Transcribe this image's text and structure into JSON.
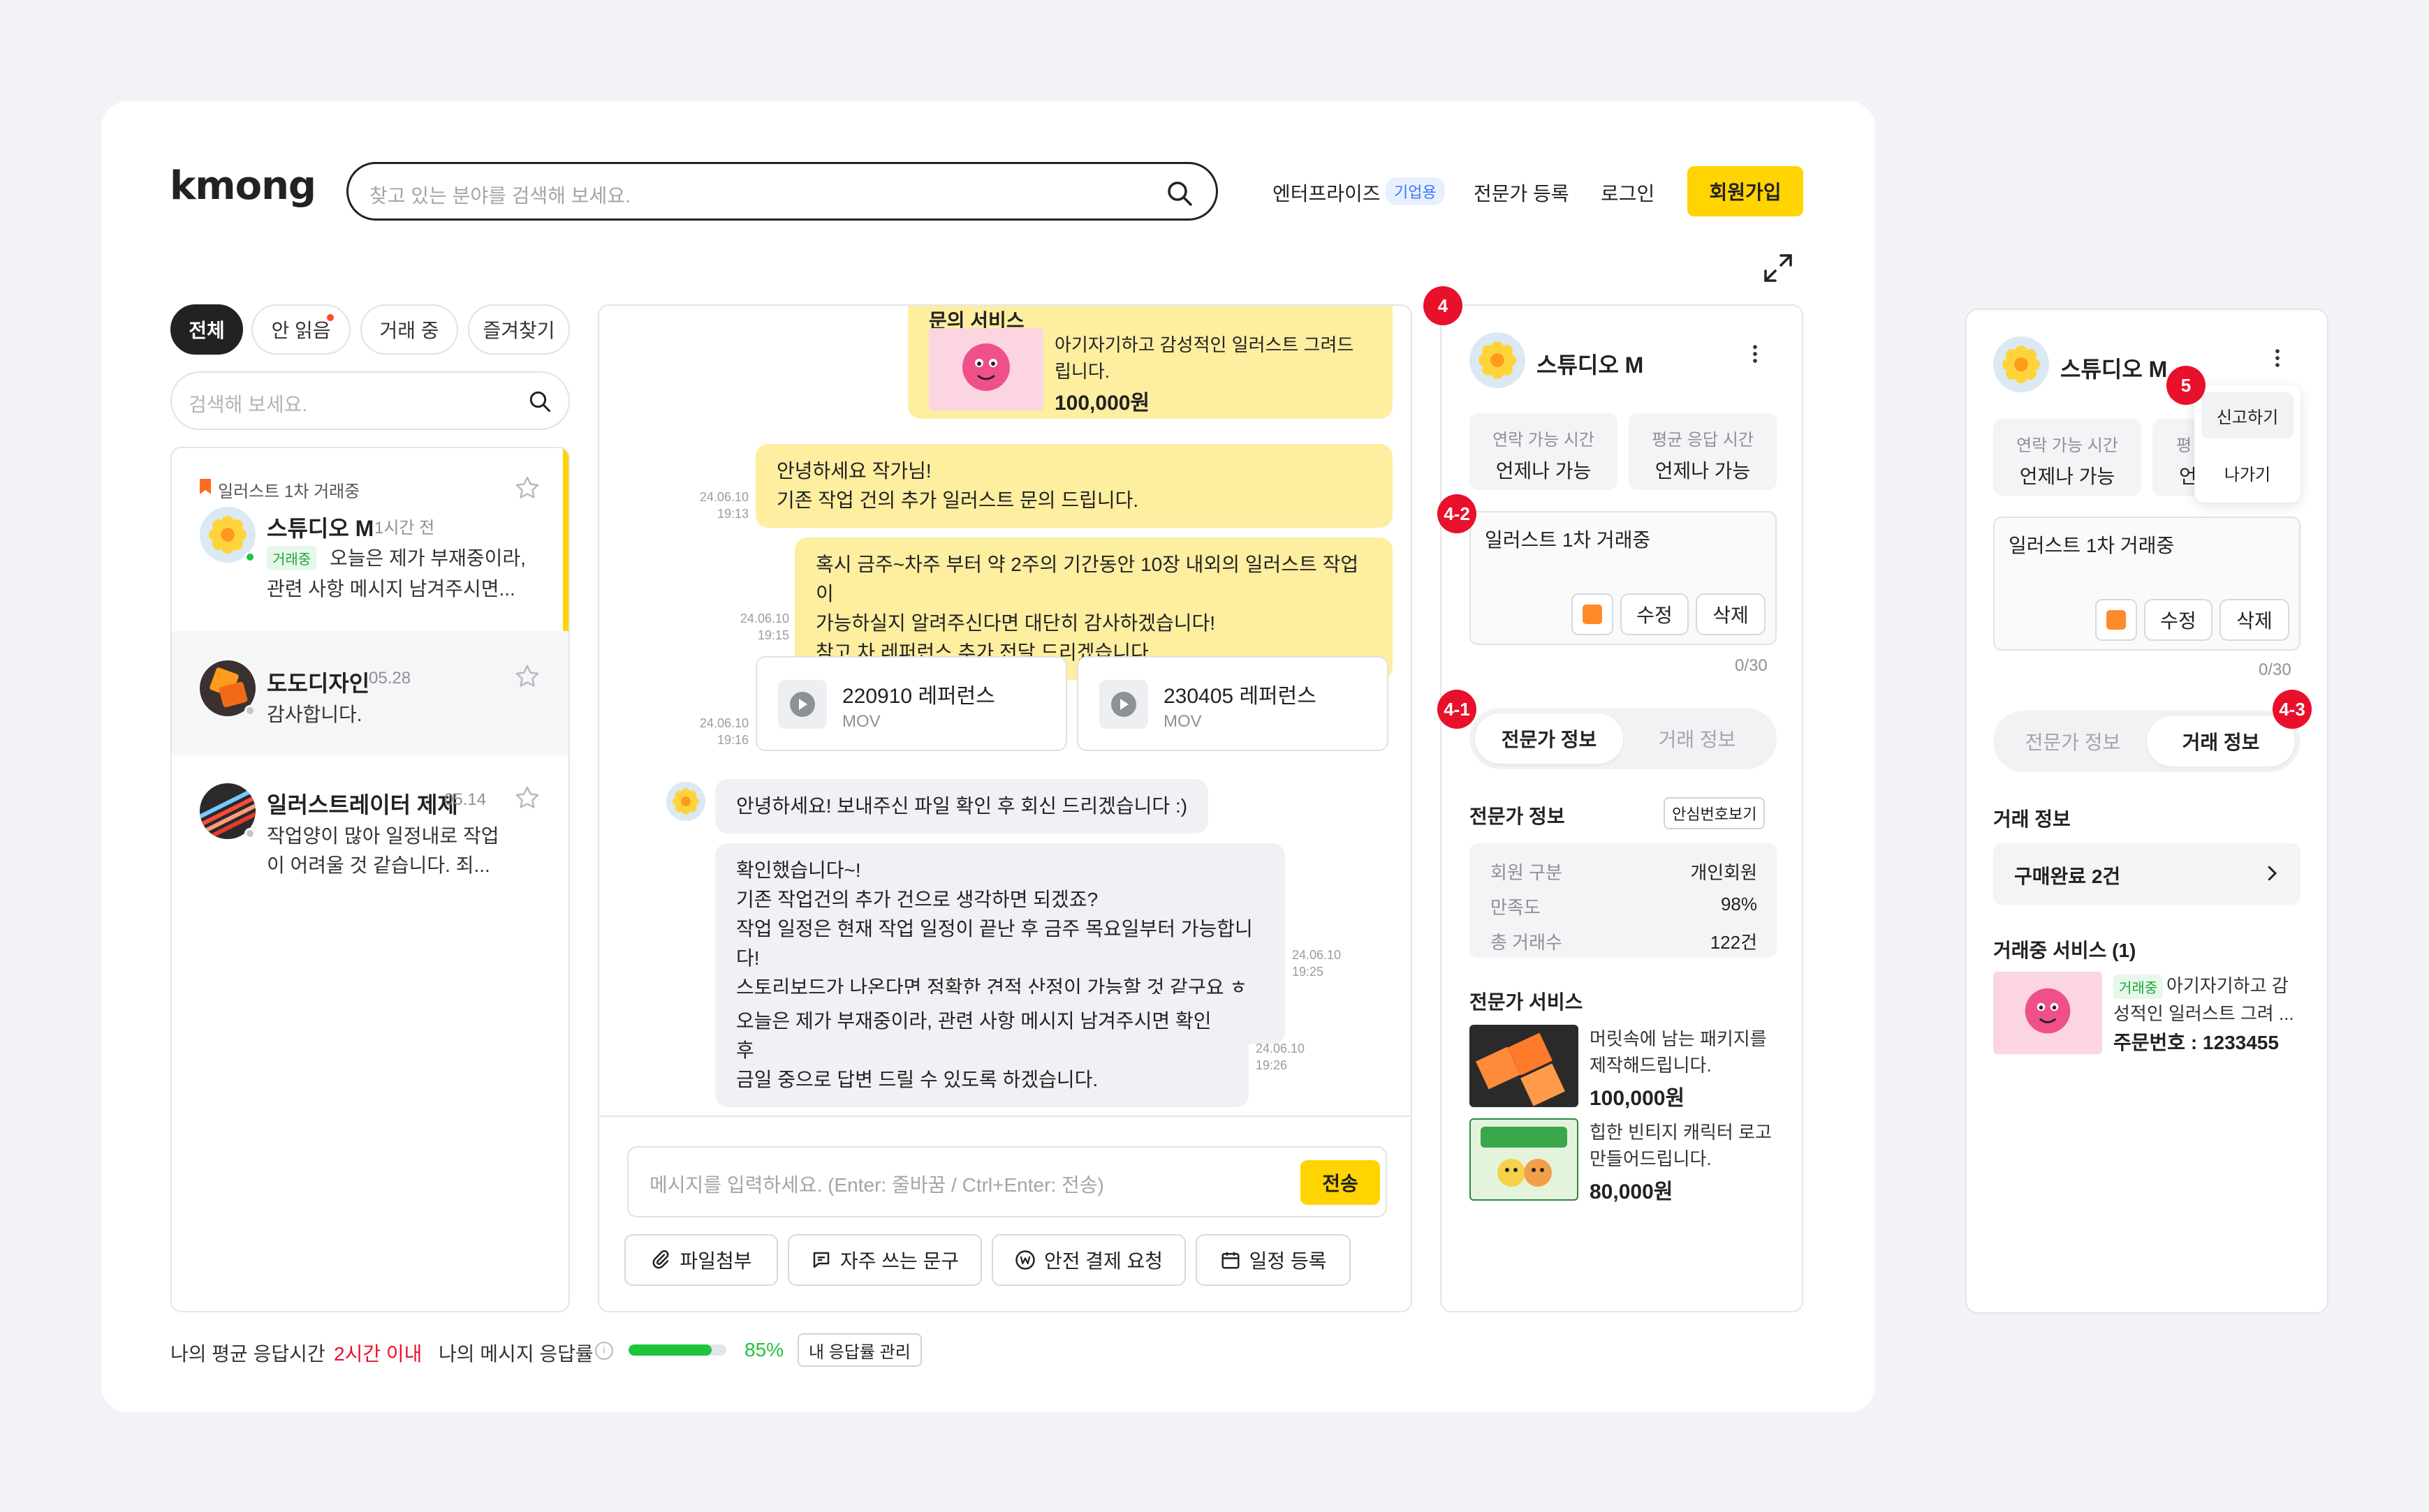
{
  "header": {
    "logo": "kmong",
    "search_placeholder": "찾고 있는 분야를 검색해 보세요.",
    "nav_enterprise": "엔터프라이즈",
    "nav_enterprise_badge": "기업용",
    "nav_expert_register": "전문가 등록",
    "nav_login": "로그인",
    "nav_signup": "회원가입"
  },
  "filters": {
    "all": "전체",
    "unread": "안 읽음",
    "trading": "거래 중",
    "favorites": "즐겨찾기"
  },
  "list_search_placeholder": "검색해 보세요.",
  "conversations": [
    {
      "tag": "일러스트 1차 거래중",
      "name": "스튜디오 M",
      "time": "1시간 전",
      "status": "거래중",
      "preview1": "오늘은 제가 부재중이라,",
      "preview2": "관련 사항 메시지 남겨주시면..."
    },
    {
      "name": "도도디자인",
      "time": "05.28",
      "preview1": "감사합니다."
    },
    {
      "name": "일러스트레이터 제제",
      "time": "05.14",
      "preview1": "작업양이 많아 일정내로 작업",
      "preview2": "이 어려울 것 같습니다. 죄..."
    }
  ],
  "chat": {
    "service_card_title": "문의 서비스",
    "service_card_desc1": "아기자기하고 감성적인 일러스트 그려드",
    "service_card_desc2": "립니다.",
    "service_card_price": "100,000원",
    "msg1_line1": "안녕하세요 작가님!",
    "msg1_line2": "기존 작업 건의 추가 일러스트 문의 드립니다.",
    "msg1_date": "24.06.10",
    "msg1_time": "19:13",
    "msg2_line1": "혹시 금주~차주 부터 약 2주의 기간동안 10장 내외의 일러스트 작업이",
    "msg2_line2": "가능하실지 알려주신다면 대단히 감사하겠습니다!",
    "msg2_line3": "참고 차 레퍼런스 추가 전달 드리겠습니다.",
    "msg2_date": "24.06.10",
    "msg2_time": "19:15",
    "file1_name": "220910 레퍼런스",
    "file1_type": "MOV",
    "file2_name": "230405 레퍼런스",
    "file2_type": "MOV",
    "files_date": "24.06.10",
    "files_time": "19:16",
    "reply1": "안녕하세요! 보내주신 파일 확인 후 회신 드리겠습니다 :)",
    "reply2_line1": "확인했습니다~!",
    "reply2_line2": "기존 작업건의 추가 건으로 생각하면 되겠죠?",
    "reply2_line3": "작업 일정은 현재 작업 일정이 끝난 후 금주 목요일부터 가능합니다!",
    "reply2_line4": "스토리보드가 나온다면 정확한 견적 산정이 가능할 것 같구요 ㅎㅎ",
    "reply2_date": "24.06.10",
    "reply2_time": "19:25",
    "reply3_line1": "오늘은 제가 부재중이라, 관련 사항 메시지 남겨주시면 확인 후",
    "reply3_line2": "금일 중으로 답변 드릴 수 있도록 하겠습니다.",
    "reply3_date": "24.06.10",
    "reply3_time": "19:26",
    "input_placeholder": "메시지를 입력하세요. (Enter: 줄바꿈 / Ctrl+Enter: 전송)",
    "send": "전송",
    "attach": "파일첨부",
    "phrases": "자주 쓰는 문구",
    "safe_pay": "안전 결제 요청",
    "schedule": "일정 등록"
  },
  "footer": {
    "avg_label": "나의 평균 응답시간",
    "avg_value": "2시간 이내",
    "rate_label": "나의 메시지 응답률",
    "rate_value": "85%",
    "rate_fraction": 0.85,
    "manage": "내 응답률 관리"
  },
  "profile": {
    "name": "스튜디오 M",
    "contact_label": "연락 가능 시간",
    "contact_value": "언제나 가능",
    "resp_label": "평균 응답 시간",
    "resp_value": "언제나 가능",
    "memo": "일러스트 1차 거래중",
    "edit": "수정",
    "delete": "삭제",
    "memo_count": "0/30",
    "tab_expert": "전문가 정보",
    "tab_trade": "거래 정보",
    "expert_info_title": "전문가 정보",
    "safe_number": "안심번호보기",
    "member_type_label": "회원 구분",
    "member_type_value": "개인회원",
    "satisfaction_label": "만족도",
    "satisfaction_value": "98%",
    "total_trades_label": "총 거래수",
    "total_trades_value": "122건",
    "services_title": "전문가 서비스",
    "svc1_line1": "머릿속에 남는 패키지를",
    "svc1_line2": "제작해드립니다.",
    "svc1_price": "100,000원",
    "svc2_line1": "힙한 빈티지 캐릭터 로고",
    "svc2_line2": "만들어드립니다.",
    "svc2_price": "80,000원"
  },
  "profile2": {
    "menu_report": "신고하기",
    "menu_leave": "나가기",
    "contact_peek": "언",
    "resp_label_peek": "평",
    "trade_info_title": "거래 정보",
    "purchase_done": "구매완료 2건",
    "trading_services_title": "거래중 서비스 (1)",
    "svc_status": "거래중",
    "svc_desc1": "아기자기하고 감",
    "svc_desc2": "성적인 일러스트 그려 ...",
    "order_number": "주문번호 : 1233455"
  },
  "badges": {
    "b4": "4",
    "b4_1": "4-1",
    "b4_2": "4-2",
    "b4_3": "4-3",
    "b5": "5"
  },
  "colors": {
    "accent_yellow": "#ffd400",
    "bubble_yellow": "#fdeea0",
    "badge_red": "#e8102a",
    "green": "#1ec53a",
    "blue_badge": "#3b7bf5"
  }
}
